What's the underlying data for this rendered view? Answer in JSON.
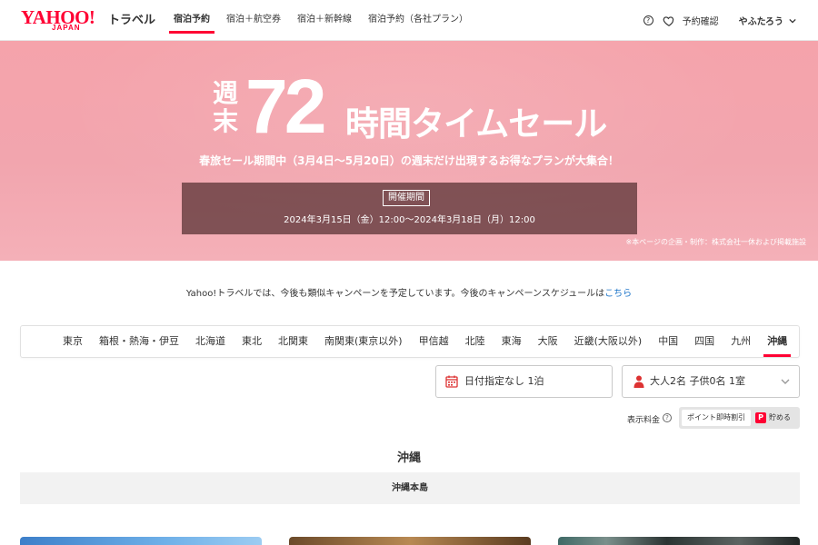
{
  "header": {
    "logo_text": "YAHOO!",
    "logo_sub": "JAPAN",
    "logo_service": "トラベル",
    "tabs": [
      {
        "label": "宿泊予約"
      },
      {
        "label": "宿泊＋航空券"
      },
      {
        "label": "宿泊＋新幹線"
      },
      {
        "label": "宿泊予約（各社プラン）"
      }
    ],
    "reserve_label": "予約確認",
    "user_label": "やふたろう"
  },
  "hero": {
    "title_shuu": "週末",
    "title_num": "72",
    "title_rest": "時間タイムセール",
    "subtitle": "春旅セール期間中（3月4日〜5月20日）の週末だけ出現するお得なプランが大集合！",
    "period_badge": "開催期間",
    "period_text": "2024年3月15日（金）12:00〜2024年3月18日（月）12:00",
    "note": "※本ページの企画・制作：株式会社一休および掲載施設"
  },
  "info": {
    "text": "Yahoo!トラベルでは、今後も類似キャンペーンを予定しています。今後のキャンペーンスケジュールは",
    "link": "こちら"
  },
  "regions": [
    "東京",
    "箱根・熱海・伊豆",
    "北海道",
    "東北",
    "北関東",
    "南関東(東京以外)",
    "甲信越",
    "北陸",
    "東海",
    "大阪",
    "近畿(大阪以外)",
    "中国",
    "四国",
    "九州",
    "沖縄"
  ],
  "search": {
    "date_label": "日付指定なし 1泊",
    "guest_label": "大人2名 子供0名 1室"
  },
  "price": {
    "label": "表示料金",
    "option_a": "ポイント即時割引",
    "option_b": "貯める",
    "option_b_icon": "P"
  },
  "section": {
    "title": "沖縄",
    "subregion": "沖縄本島"
  },
  "colors": {
    "accent": "#ff0033",
    "hero_bg": "#f5a3ab",
    "link": "#1a73c8"
  }
}
